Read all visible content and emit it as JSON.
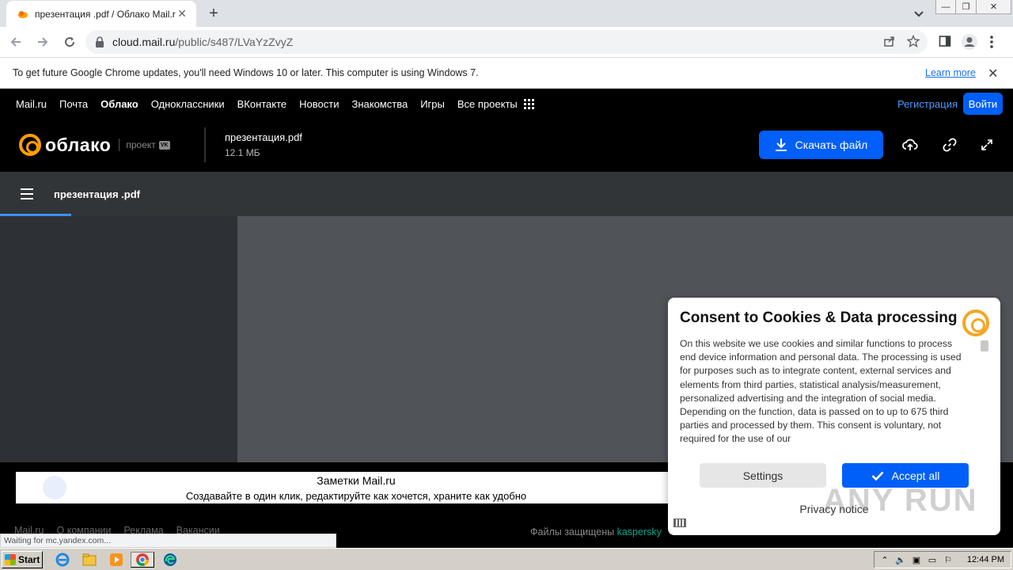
{
  "browser": {
    "tab_title": "презентация .pdf / Облако Mail.ru",
    "url_host": "cloud.mail.ru",
    "url_path": "/public/s487/LVaYzZvyZ"
  },
  "infobar": {
    "message": "To get future Google Chrome updates, you'll need Windows 10 or later. This computer is using Windows 7.",
    "learn_more": "Learn more"
  },
  "portal_nav": {
    "items": [
      "Mail.ru",
      "Почта",
      "Облако",
      "Одноклассники",
      "ВКонтакте",
      "Новости",
      "Знакомства",
      "Игры",
      "Все проекты"
    ],
    "register": "Регистрация",
    "login": "Войти"
  },
  "cloud_header": {
    "logo_word": "облако",
    "project_label": "проект",
    "vk_badge": "VK",
    "file_name": "презентация.pdf",
    "file_size": "12.1 МБ",
    "download_label": "Скачать файл"
  },
  "viewer": {
    "title": "презентация .pdf"
  },
  "ad": {
    "title": "Заметки Mail.ru",
    "text": "Создавайте в один клик, редактируйте как хочется, храните как удобно"
  },
  "footer": {
    "links": [
      "Mail.ru",
      "О компании",
      "Реклама",
      "Вакансии"
    ],
    "protected_prefix": "Файлы защищены",
    "protected_brand": "kaspersky"
  },
  "status_bar": "Waiting for mc.yandex.com...",
  "consent": {
    "title": "Consent to Cookies & Data processing",
    "body": "On this website we use cookies and similar functions to process end device information and personal data. The processing is used for purposes such as to integrate content, external services and elements from third parties, statistical analysis/measurement, personalized advertising and the integration of social media. Depending on the function, data is passed on to up to 675 third parties and processed by them. This consent is voluntary, not required for the use of our",
    "settings": "Settings",
    "accept": "Accept all",
    "privacy": "Privacy notice"
  },
  "watermark": "ANY RUN",
  "taskbar": {
    "start": "Start",
    "clock": "12:44 PM"
  },
  "colors": {
    "accent_blue": "#005ff9",
    "brand_orange": "#ff9e00"
  }
}
